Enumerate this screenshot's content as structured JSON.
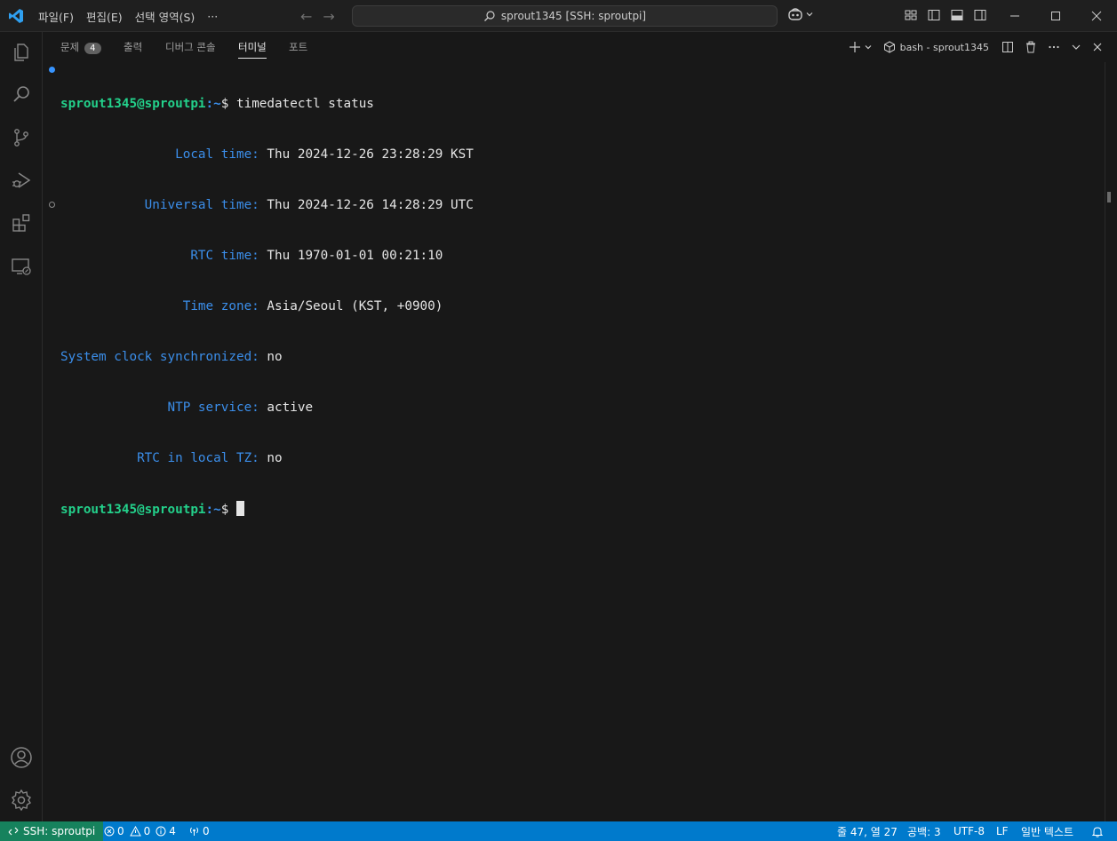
{
  "titlebar": {
    "menu": [
      "파일(F)",
      "편집(E)",
      "선택 영역(S)",
      "···"
    ],
    "search_text": "sprout1345 [SSH: sproutpi]"
  },
  "panel": {
    "tabs": [
      {
        "label": "문제",
        "badge": "4"
      },
      {
        "label": "출력"
      },
      {
        "label": "디버그 콘솔"
      },
      {
        "label": "터미널",
        "active": true
      },
      {
        "label": "포트"
      }
    ],
    "terminal_instance": "bash - sprout1345"
  },
  "terminal": {
    "prompt_user": "sprout1345@sproutpi",
    "prompt_path": ":~",
    "prompt_symbol": "$ ",
    "command": "timedatectl status",
    "rows": [
      {
        "label": "               Local time:",
        "value": " Thu 2024-12-26 23:28:29 KST"
      },
      {
        "label": "           Universal time:",
        "value": " Thu 2024-12-26 14:28:29 UTC"
      },
      {
        "label": "                 RTC time:",
        "value": " Thu 1970-01-01 00:21:10"
      },
      {
        "label": "                Time zone:",
        "value": " Asia/Seoul (KST, +0900)"
      },
      {
        "label": "System clock synchronized:",
        "value": " no"
      },
      {
        "label": "              NTP service:",
        "value": " active"
      },
      {
        "label": "          RTC in local TZ:",
        "value": " no"
      }
    ]
  },
  "statusbar": {
    "remote": "SSH: sproutpi",
    "errors": "0",
    "warnings": "0",
    "info": "4",
    "ports": "0",
    "position": "줄 47, 열 27",
    "spaces": "공백: 3",
    "encoding": "UTF-8",
    "eol": "LF",
    "language": "일반 텍스트"
  },
  "colors": {
    "status_bg": "#007acc",
    "remote_bg": "#16825d",
    "prompt_green": "#23d18b",
    "label_blue": "#3b8eea"
  },
  "icons": {
    "activity": [
      "explorer-icon",
      "search-icon",
      "source-control-icon",
      "run-debug-icon",
      "extensions-icon",
      "remote-explorer-icon",
      "account-icon",
      "settings-gear-icon"
    ]
  }
}
